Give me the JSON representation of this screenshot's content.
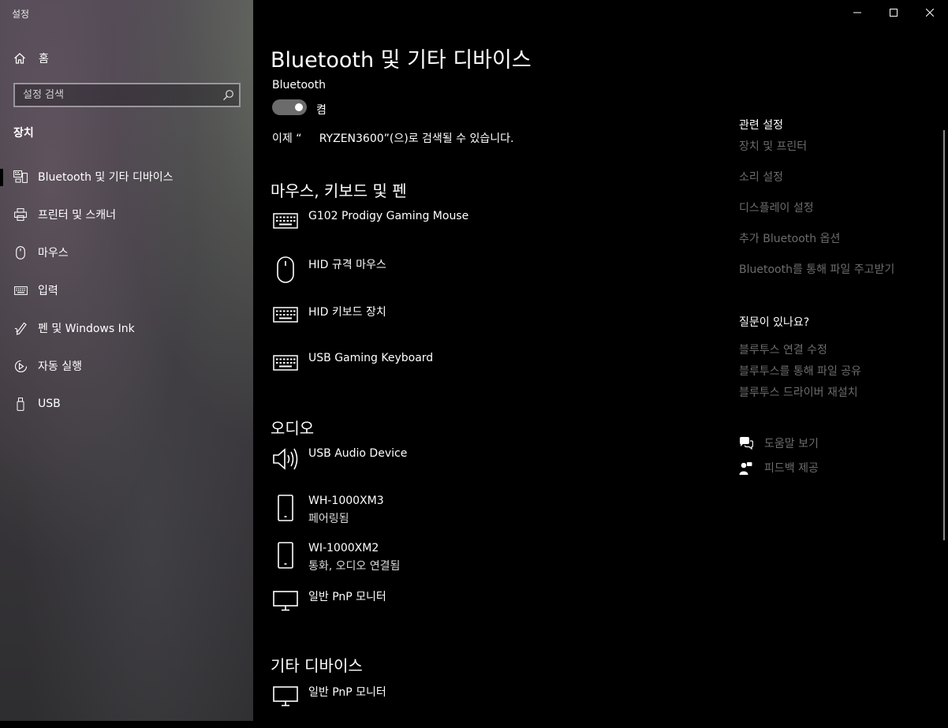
{
  "window": {
    "title": "설정",
    "controls": [
      "minimize-icon",
      "maximize-icon",
      "close-icon"
    ]
  },
  "sidebar": {
    "home_label": "홈",
    "search_placeholder": "설정 검색",
    "section": "장치",
    "items": [
      {
        "label": "Bluetooth 및 기타 디바이스",
        "icon": "bluetooth-devices-icon",
        "selected": true
      },
      {
        "label": "프린터 및 스캐너",
        "icon": "printer-icon"
      },
      {
        "label": "마우스",
        "icon": "mouse-icon"
      },
      {
        "label": "입력",
        "icon": "keyboard-icon"
      },
      {
        "label": "펜 및 Windows Ink",
        "icon": "pen-icon"
      },
      {
        "label": "자동 실행",
        "icon": "autoplay-icon"
      },
      {
        "label": "USB",
        "icon": "usb-icon"
      }
    ]
  },
  "main": {
    "title": "Bluetooth 및 기타 디바이스",
    "bluetooth_label": "Bluetooth",
    "toggle_state": "켬",
    "discoverable_text": "이제 “     RYZEN3600”(으)로 검색될 수 있습니다.",
    "groups": [
      {
        "title": "마우스, 키보드 및 펜",
        "devices": [
          {
            "name": "G102 Prodigy Gaming Mouse",
            "status": "",
            "icon": "keyboard-icon"
          },
          {
            "name": "HID 규격 마우스",
            "status": "",
            "icon": "mouse-icon"
          },
          {
            "name": "HID 키보드 장치",
            "status": "",
            "icon": "keyboard-icon"
          },
          {
            "name": "USB Gaming Keyboard",
            "status": "",
            "icon": "keyboard-icon"
          }
        ]
      },
      {
        "title": "오디오",
        "devices": [
          {
            "name": "USB Audio Device",
            "status": "",
            "icon": "speaker-icon"
          },
          {
            "name": "WH-1000XM3",
            "status": "페어링됨",
            "icon": "phone-icon"
          },
          {
            "name": "WI-1000XM2",
            "status": "통화, 오디오 연결됨",
            "icon": "phone-icon"
          },
          {
            "name": "일반 PnP 모니터",
            "status": "",
            "icon": "monitor-icon"
          }
        ]
      },
      {
        "title": "기타 디바이스",
        "devices": [
          {
            "name": "일반 PnP 모니터",
            "status": "",
            "icon": "monitor-icon"
          }
        ]
      }
    ]
  },
  "related": {
    "heading": "관련 설정",
    "links": [
      "장치 및 프린터",
      "소리 설정",
      "디스플레이 설정",
      "추가 Bluetooth 옵션",
      "Bluetooth를 통해 파일 주고받기"
    ],
    "question_heading": "질문이 있나요?",
    "question_links": [
      "블루투스 연결 수정",
      "블루투스를 통해 파일 공유",
      "블루투스 드라이버 재설치"
    ],
    "help_label": "도움말 보기",
    "feedback_label": "피드백 제공"
  },
  "colors": {
    "background": "#000000",
    "link_disabled": "#6c6c6c",
    "toggle_track": "#6b6b6b"
  }
}
